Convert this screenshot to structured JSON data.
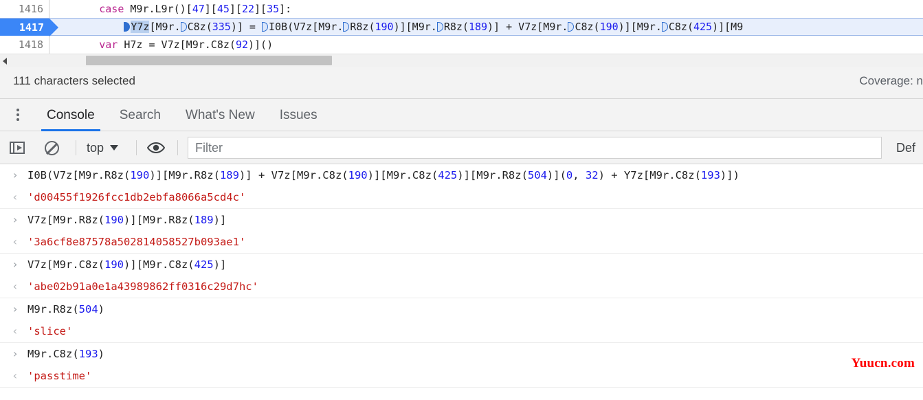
{
  "editor": {
    "lines": [
      {
        "number": "1416",
        "active": false,
        "segments": [
          {
            "text": "        ",
            "type": "plain"
          },
          {
            "text": "case",
            "type": "kw"
          },
          {
            "text": " M9r.L9r()[",
            "type": "plain"
          },
          {
            "text": "47",
            "type": "num"
          },
          {
            "text": "][",
            "type": "plain"
          },
          {
            "text": "45",
            "type": "num"
          },
          {
            "text": "][",
            "type": "plain"
          },
          {
            "text": "22",
            "type": "num"
          },
          {
            "text": "][",
            "type": "plain"
          },
          {
            "text": "35",
            "type": "num"
          },
          {
            "text": "]:",
            "type": "plain"
          }
        ]
      },
      {
        "number": "1417",
        "active": true,
        "segments": [
          {
            "text": "            ",
            "type": "plain"
          },
          {
            "text": "",
            "type": "marker-solid"
          },
          {
            "text": "Y7z",
            "type": "sel"
          },
          {
            "text": "[M9r.",
            "type": "plain"
          },
          {
            "text": "",
            "type": "marker"
          },
          {
            "text": "C8z(",
            "type": "plain"
          },
          {
            "text": "335",
            "type": "num"
          },
          {
            "text": ")] = ",
            "type": "plain"
          },
          {
            "text": "",
            "type": "marker"
          },
          {
            "text": "I0B(V7z[M9r.",
            "type": "plain"
          },
          {
            "text": "",
            "type": "marker"
          },
          {
            "text": "R8z(",
            "type": "plain"
          },
          {
            "text": "190",
            "type": "num"
          },
          {
            "text": ")][M9r.",
            "type": "plain"
          },
          {
            "text": "",
            "type": "marker"
          },
          {
            "text": "R8z(",
            "type": "plain"
          },
          {
            "text": "189",
            "type": "num"
          },
          {
            "text": ")] + V7z[M9r.",
            "type": "plain"
          },
          {
            "text": "",
            "type": "marker"
          },
          {
            "text": "C8z(",
            "type": "plain"
          },
          {
            "text": "190",
            "type": "num"
          },
          {
            "text": ")][M9r.",
            "type": "plain"
          },
          {
            "text": "",
            "type": "marker"
          },
          {
            "text": "C8z(",
            "type": "plain"
          },
          {
            "text": "425",
            "type": "num"
          },
          {
            "text": ")][M9",
            "type": "plain"
          }
        ]
      },
      {
        "number": "1418",
        "active": false,
        "segments": [
          {
            "text": "        ",
            "type": "plain"
          },
          {
            "text": "var",
            "type": "kw"
          },
          {
            "text": " H7z = V7z[M9r.C8z(",
            "type": "plain"
          },
          {
            "text": "92",
            "type": "num"
          },
          {
            "text": ")]()",
            "type": "plain"
          }
        ]
      }
    ]
  },
  "statusbar": {
    "selection_text": "111 characters selected",
    "coverage_text": "Coverage: n"
  },
  "drawer": {
    "menu_icon": "kebab-menu-icon",
    "tabs": [
      {
        "label": "Console",
        "active": true
      },
      {
        "label": "Search",
        "active": false
      },
      {
        "label": "What's New",
        "active": false
      },
      {
        "label": "Issues",
        "active": false
      }
    ]
  },
  "console_toolbar": {
    "sidebar_toggle_icon": "sidebar-toggle-icon",
    "clear_console_icon": "clear-console-icon",
    "context_value": "top",
    "context_caret_icon": "chevron-down-icon",
    "eye_icon": "eye-icon",
    "filter_placeholder": "Filter",
    "filter_value": "",
    "levels_label": "Def"
  },
  "console_messages": [
    {
      "icon": "›",
      "kind": "input",
      "group_end": false,
      "segments": [
        {
          "text": "I0B(V7z[M9r.R8z(",
          "type": "plain"
        },
        {
          "text": "190",
          "type": "num"
        },
        {
          "text": ")][M9r.R8z(",
          "type": "plain"
        },
        {
          "text": "189",
          "type": "num"
        },
        {
          "text": ")] + V7z[M9r.C8z(",
          "type": "plain"
        },
        {
          "text": "190",
          "type": "num"
        },
        {
          "text": ")][M9r.C8z(",
          "type": "plain"
        },
        {
          "text": "425",
          "type": "num"
        },
        {
          "text": ")][M9r.R8z(",
          "type": "plain"
        },
        {
          "text": "504",
          "type": "num"
        },
        {
          "text": ")](",
          "type": "plain"
        },
        {
          "text": "0",
          "type": "num"
        },
        {
          "text": ", ",
          "type": "plain"
        },
        {
          "text": "32",
          "type": "num"
        },
        {
          "text": ") + Y7z[M9r.C8z(",
          "type": "plain"
        },
        {
          "text": "193",
          "type": "num"
        },
        {
          "text": ")])",
          "type": "plain"
        }
      ]
    },
    {
      "icon": "‹",
      "kind": "result",
      "group_end": true,
      "segments": [
        {
          "text": "'d00455f1926fcc1db2ebfa8066a5cd4c'",
          "type": "plain"
        }
      ]
    },
    {
      "icon": "›",
      "kind": "input",
      "group_end": false,
      "segments": [
        {
          "text": "V7z[M9r.R8z(",
          "type": "plain"
        },
        {
          "text": "190",
          "type": "num"
        },
        {
          "text": ")][M9r.R8z(",
          "type": "plain"
        },
        {
          "text": "189",
          "type": "num"
        },
        {
          "text": ")]",
          "type": "plain"
        }
      ]
    },
    {
      "icon": "‹",
      "kind": "result",
      "group_end": true,
      "segments": [
        {
          "text": "'3a6cf8e87578a502814058527b093ae1'",
          "type": "plain"
        }
      ]
    },
    {
      "icon": "›",
      "kind": "input",
      "group_end": false,
      "segments": [
        {
          "text": "V7z[M9r.C8z(",
          "type": "plain"
        },
        {
          "text": "190",
          "type": "num"
        },
        {
          "text": ")][M9r.C8z(",
          "type": "plain"
        },
        {
          "text": "425",
          "type": "num"
        },
        {
          "text": ")]",
          "type": "plain"
        }
      ]
    },
    {
      "icon": "‹",
      "kind": "result",
      "group_end": true,
      "segments": [
        {
          "text": "'abe02b91a0e1a43989862ff0316c29d7hc'",
          "type": "plain"
        }
      ]
    },
    {
      "icon": "›",
      "kind": "input",
      "group_end": false,
      "segments": [
        {
          "text": "M9r.R8z(",
          "type": "plain"
        },
        {
          "text": "504",
          "type": "num"
        },
        {
          "text": ")",
          "type": "plain"
        }
      ]
    },
    {
      "icon": "‹",
      "kind": "result",
      "group_end": true,
      "segments": [
        {
          "text": "'slice'",
          "type": "plain"
        }
      ]
    },
    {
      "icon": "›",
      "kind": "input",
      "group_end": false,
      "segments": [
        {
          "text": "M9r.C8z(",
          "type": "plain"
        },
        {
          "text": "193",
          "type": "num"
        },
        {
          "text": ")",
          "type": "plain"
        }
      ]
    },
    {
      "icon": "‹",
      "kind": "result",
      "group_end": true,
      "segments": [
        {
          "text": "'passtime'",
          "type": "plain"
        }
      ]
    }
  ],
  "watermark": {
    "text": "Yuucn.com"
  },
  "colors": {
    "accent": "#1a73e8",
    "active_line_gutter": "#3b86f7",
    "active_line_bg": "#e8effc",
    "keyword": "#b9258f",
    "number": "#1a1aee",
    "result_string": "#c41a16",
    "watermark": "#ff0000"
  }
}
